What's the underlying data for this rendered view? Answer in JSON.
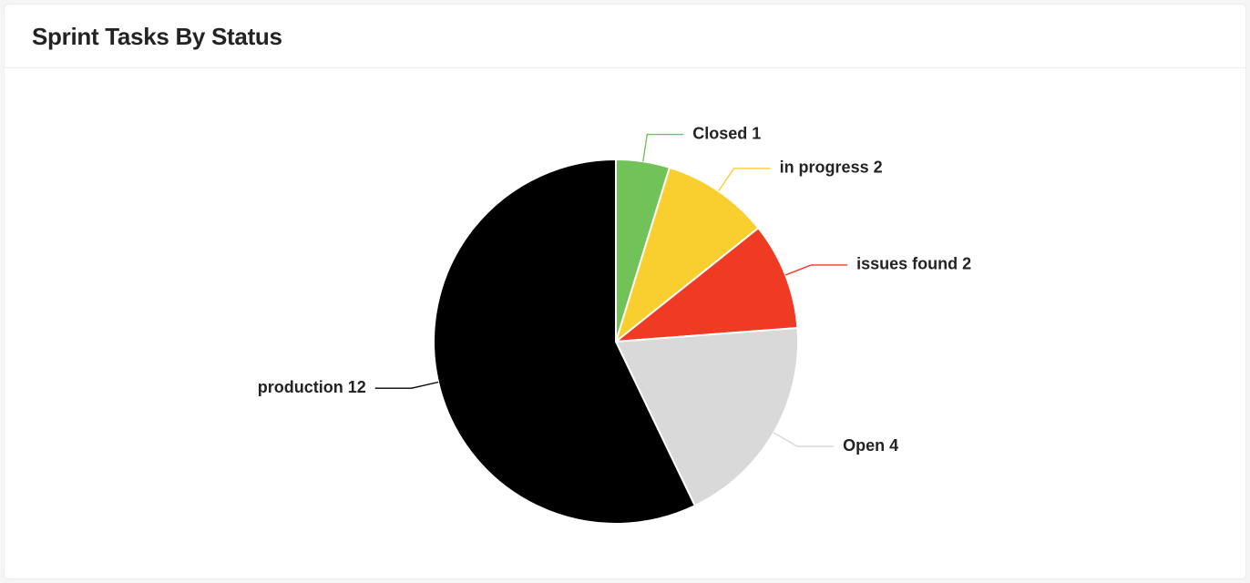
{
  "card": {
    "title": "Sprint Tasks By Status"
  },
  "chart_data": {
    "type": "pie",
    "title": "Sprint Tasks By Status",
    "series": [
      {
        "name": "Closed",
        "value": 1,
        "color": "#72c25a"
      },
      {
        "name": "in progress",
        "value": 2,
        "color": "#f9ce2f"
      },
      {
        "name": "issues found",
        "value": 2,
        "color": "#ef3b24"
      },
      {
        "name": "Open",
        "value": 4,
        "color": "#d9d9d9"
      },
      {
        "name": "production",
        "value": 12,
        "color": "#000000"
      }
    ]
  }
}
